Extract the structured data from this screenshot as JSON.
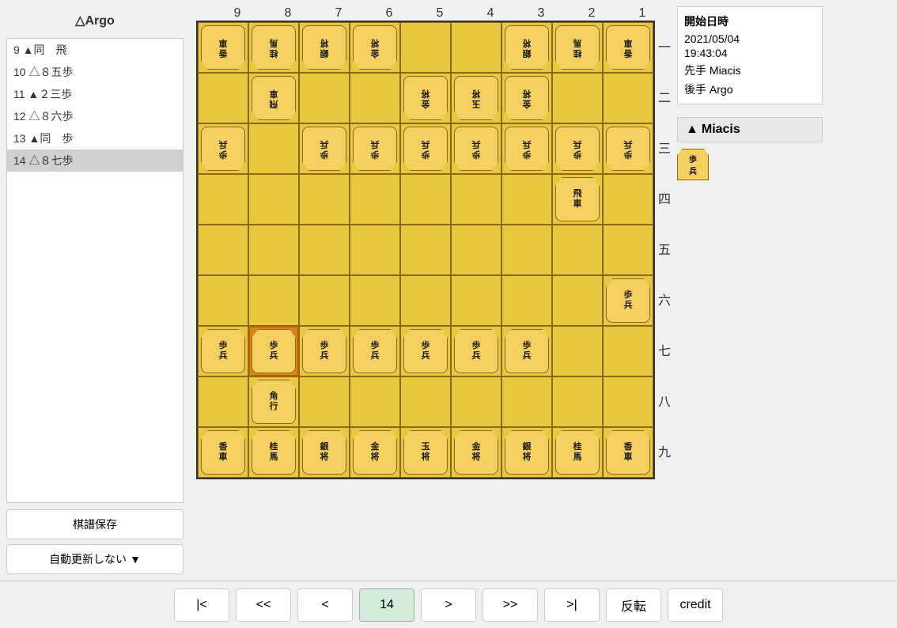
{
  "players": {
    "top": "△Argo",
    "bottom_sente": "Miacis",
    "bottom_gote": "Argo"
  },
  "game_info": {
    "title": "開始日時",
    "date": "2021/05/04",
    "time": "19:43:04",
    "sente_label": "先手",
    "sente_name": "Miacis",
    "gote_label": "後手",
    "gote_name": "Argo"
  },
  "moves": [
    {
      "num": "9",
      "text": "9 ▲同　飛"
    },
    {
      "num": "10",
      "text": "10 △８五歩"
    },
    {
      "num": "11",
      "text": "11 ▲２三歩"
    },
    {
      "num": "12",
      "text": "12 △８六歩"
    },
    {
      "num": "13",
      "text": "13 ▲同　歩"
    },
    {
      "num": "14",
      "text": "14 △８七歩",
      "selected": true
    }
  ],
  "col_labels": [
    "9",
    "8",
    "7",
    "6",
    "5",
    "4",
    "3",
    "2",
    "1"
  ],
  "row_labels": [
    "一",
    "二",
    "三",
    "四",
    "五",
    "六",
    "七",
    "八",
    "九"
  ],
  "nav_buttons": {
    "first": "|<",
    "prev_prev": "<<",
    "prev": "<",
    "current": "14",
    "next": ">",
    "next_next": ">>",
    "last": ">|",
    "flip": "反転",
    "credit": "credit"
  },
  "bottom_buttons": {
    "save_kifu": "棋譜保存",
    "auto_update": "自動更新しない"
  },
  "player_bottom": {
    "name": "▲Miacis"
  },
  "colors": {
    "board": "#e8c840",
    "piece_bg": "#f5d060",
    "highlight": "#d4871a",
    "accent_green": "#d4edda"
  }
}
